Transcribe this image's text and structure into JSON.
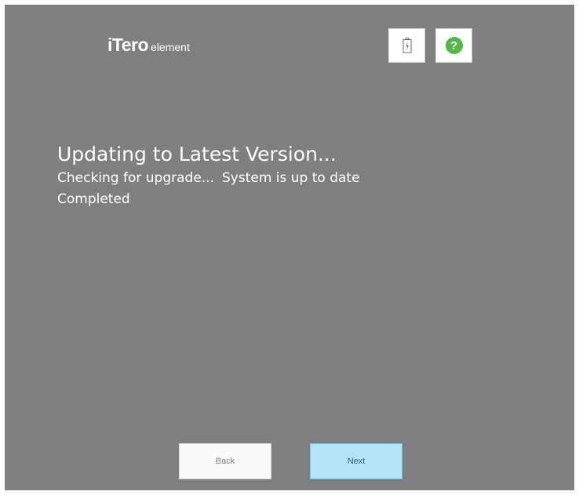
{
  "header": {
    "logo": {
      "brand": "iTero",
      "product": "element"
    },
    "battery_icon": "battery-charging-icon",
    "help_icon": "help-question-icon",
    "help_glyph": "?",
    "help_color": "#52b947"
  },
  "main": {
    "title": "Updating to Latest Version...",
    "status_check": "Checking for upgrade...",
    "status_result": "System is up to date",
    "status_completed": "Completed"
  },
  "footer": {
    "back_label": "Back",
    "next_label": "Next"
  },
  "colors": {
    "background": "#7f7f81",
    "next_button": "#b5e2f6",
    "back_button": "#fafafa",
    "text": "#ffffff"
  }
}
